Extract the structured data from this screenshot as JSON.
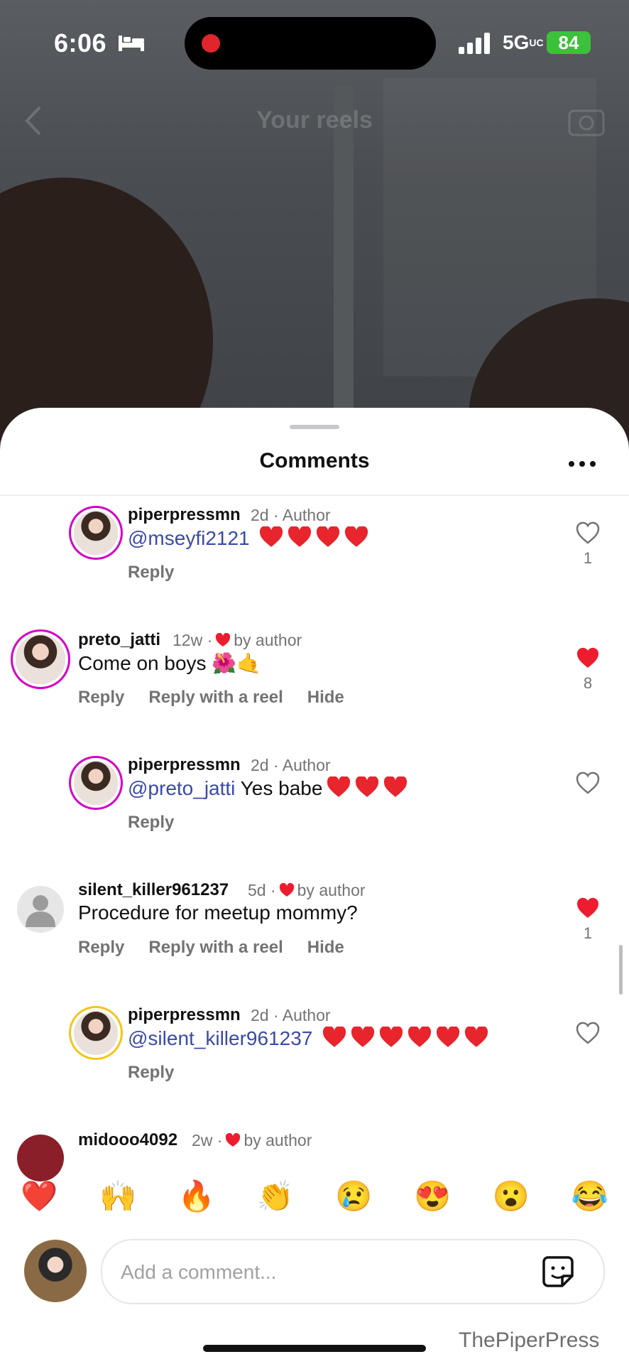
{
  "status_bar": {
    "time": "6:06",
    "network": "5G",
    "network_suffix": "UC",
    "battery": "84"
  },
  "header": {
    "title": "Your reels"
  },
  "sheet": {
    "title": "Comments"
  },
  "comments": [
    {
      "username": "piperpressmn",
      "meta": "2d · Author",
      "mention": "@mseyfi2121",
      "text": "",
      "hearts": 4,
      "actions": [
        "Reply"
      ],
      "likes": "1",
      "liked": false
    },
    {
      "username": "preto_jatti",
      "meta_prefix": "12w ·",
      "meta_suffix": "by author",
      "text": "Come on boys 🌺🤙",
      "actions": [
        "Reply",
        "Reply with a reel",
        "Hide"
      ],
      "likes": "8",
      "liked": true
    },
    {
      "username": "piperpressmn",
      "meta": "2d · Author",
      "mention": "@preto_jatti",
      "text": " Yes babe",
      "hearts": 3,
      "actions": [
        "Reply"
      ],
      "likes": "",
      "liked": false
    },
    {
      "username": "silent_killer961237",
      "meta_prefix": "5d ·",
      "meta_suffix": "by author",
      "text": "Procedure for meetup mommy?",
      "actions": [
        "Reply",
        "Reply with a reel",
        "Hide"
      ],
      "likes": "1",
      "liked": true
    },
    {
      "username": "piperpressmn",
      "meta": "2d · Author",
      "mention": "@silent_killer961237",
      "text": "",
      "hearts": 6,
      "actions": [
        "Reply"
      ],
      "likes": "",
      "liked": false
    },
    {
      "username": "midooo4092",
      "meta_prefix": "2w ·",
      "meta_suffix": "by author"
    }
  ],
  "emoji_bar": [
    "❤️",
    "🙌",
    "🔥",
    "👏",
    "😢",
    "😍",
    "😮",
    "😂"
  ],
  "composer": {
    "placeholder": "Add a comment..."
  },
  "watermark": "ThePiperPress",
  "colors": {
    "like_red": "#ed1c2e",
    "mention": "#3a4aa8",
    "story_ring": "#d300c5",
    "battery": "#3cc13b"
  }
}
